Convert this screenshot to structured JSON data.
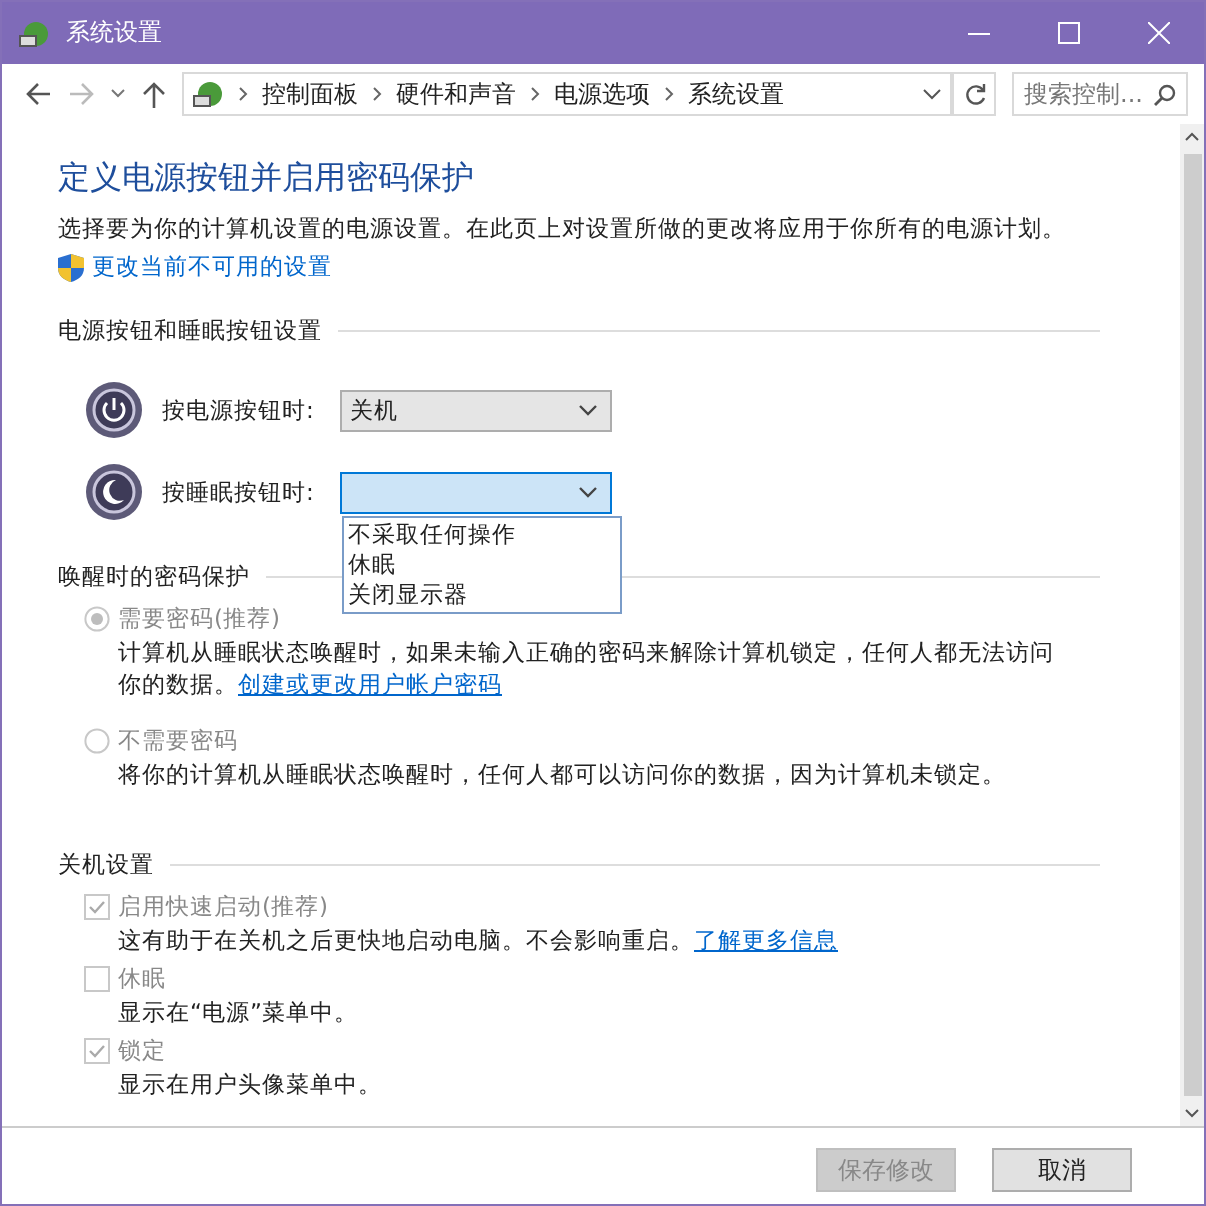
{
  "window": {
    "title": "系统设置"
  },
  "address_bar": {
    "crumbs": [
      "控制面板",
      "硬件和声音",
      "电源选项",
      "系统设置"
    ]
  },
  "search": {
    "placeholder": "搜索控制..."
  },
  "heading": "定义电源按钮并启用密码保护",
  "intro": "选择要为你的计算机设置的电源设置。在此页上对设置所做的更改将应用于你所有的电源计划。",
  "admin_link": "更改当前不可用的设置",
  "button_section": {
    "title": "电源按钮和睡眠按钮设置",
    "rows": [
      {
        "kind": "power",
        "label": "按电源按钮时:",
        "value": "关机",
        "expanded": false
      },
      {
        "kind": "sleep",
        "label": "按睡眠按钮时:",
        "expanded": true,
        "options": [
          "不采取任何操作",
          "休眠",
          "关闭显示器"
        ]
      }
    ]
  },
  "password_section": {
    "title": "唤醒时的密码保护",
    "options": [
      {
        "label": "需要密码(推荐)",
        "selected": true,
        "disabled": true,
        "description": "计算机从睡眠状态唤醒时，如果未输入正确的密码来解除计算机锁定，任何人都无法访问你的数据。",
        "link": "创建或更改用户帐户密码"
      },
      {
        "label": "不需要密码",
        "selected": false,
        "disabled": true,
        "description": "将你的计算机从睡眠状态唤醒时，任何人都可以访问你的数据，因为计算机未锁定。"
      }
    ]
  },
  "shutdown_section": {
    "title": "关机设置",
    "items": [
      {
        "label": "启用快速启动(推荐)",
        "checked": true,
        "disabled": true,
        "description": "这有助于在关机之后更快地启动电脑。不会影响重启。",
        "link": "了解更多信息"
      },
      {
        "label": "休眠",
        "checked": false,
        "disabled": true,
        "description": "显示在“电源”菜单中。"
      },
      {
        "label": "锁定",
        "checked": true,
        "disabled": true,
        "description": "显示在用户头像菜单中。"
      }
    ]
  },
  "buttons": [
    {
      "label": "保存修改",
      "disabled": true
    },
    {
      "label": "取消",
      "disabled": false
    }
  ]
}
